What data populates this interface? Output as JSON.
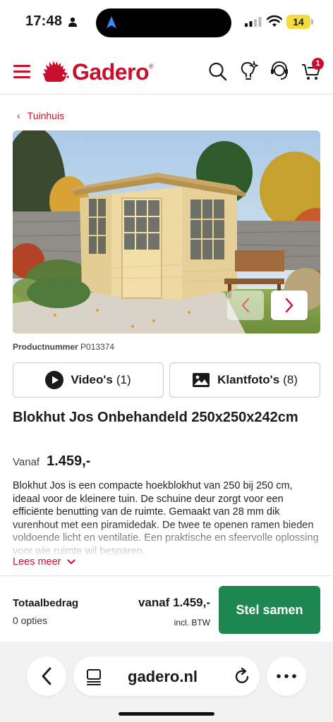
{
  "status_bar": {
    "time": "17:48",
    "battery": "14"
  },
  "header": {
    "logo_text": "Gadero",
    "logo_reg": "®",
    "cart_count": "1",
    "brand_color": "#c8102e"
  },
  "breadcrumb": {
    "label": "Tuinhuis"
  },
  "product": {
    "number_label": "Productnummer",
    "number_value": "P013374",
    "videos_label": "Video's",
    "videos_count": "(1)",
    "photos_label": "Klantfoto's",
    "photos_count": "(8)",
    "title": "Blokhut Jos Onbehandeld 250x250x242cm",
    "price_label": "Vanaf",
    "price": "1.459,-",
    "description": "Blokhut Jos is een compacte hoekblokhut van 250 bij 250 cm, ideaal voor de kleinere tuin. De schuine deur zorgt voor een efficiënte benutting van de ruimte. Gemaakt van 28 mm dik vurenhout met een piramidedak. De twee te openen ramen bieden voldoende licht en ventilatie. Een praktische en sfeervolle oplossing voor wie ruimte wil besparen.",
    "read_more": "Lees meer"
  },
  "bottom_bar": {
    "total_label": "Totaalbedrag",
    "options": "0 opties",
    "total_price": "vanaf 1.459,-",
    "btw": "incl. BTW",
    "cta_label": "Stel samen",
    "cta_color": "#1e8650"
  },
  "browser": {
    "url": "gadero.nl"
  }
}
